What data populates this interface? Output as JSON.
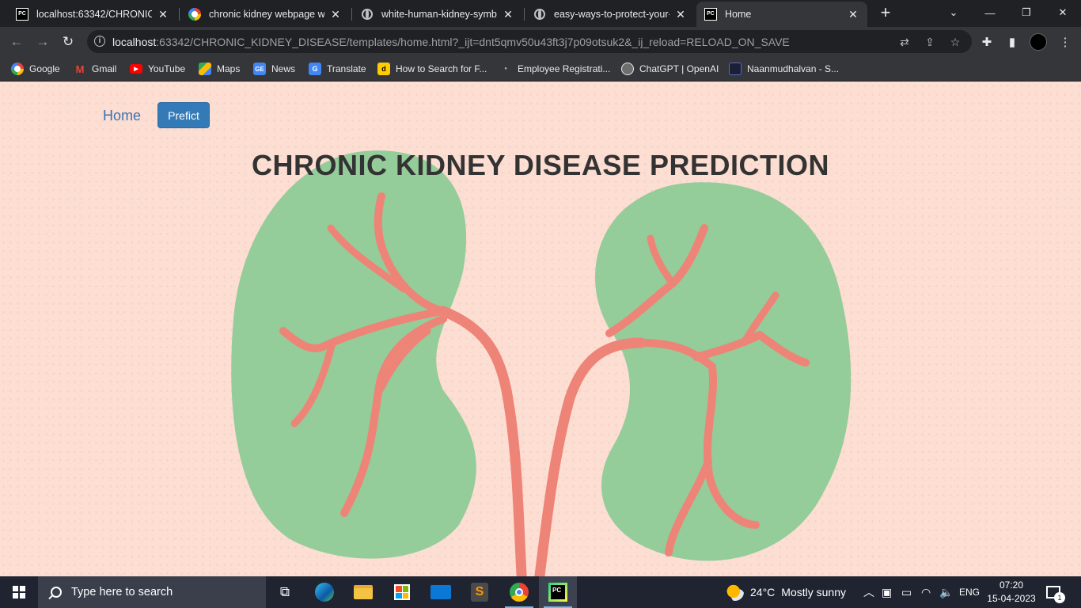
{
  "browser": {
    "tabs": [
      {
        "title": "localhost:63342/CHRONIC_KIDNEY",
        "icon": "pycharm-icon"
      },
      {
        "title": "chronic kidney webpage wallpaper",
        "icon": "google-icon"
      },
      {
        "title": "white-human-kidney-symbol",
        "icon": "globe-icon"
      },
      {
        "title": "easy-ways-to-protect-your-kidney",
        "icon": "globe-icon"
      },
      {
        "title": "Home",
        "icon": "pycharm-icon"
      }
    ],
    "new_tab": "+",
    "url_host": "localhost",
    "url_rest": ":63342/CHRONIC_KIDNEY_DISEASE/templates/home.html?_ijt=dnt5qmv50u43ft3j7p09otsuk2&_ij_reload=RELOAD_ON_SAVE",
    "bookmarks": [
      {
        "label": "Google",
        "icon": "google-icon"
      },
      {
        "label": "Gmail",
        "icon": "gmail-icon"
      },
      {
        "label": "YouTube",
        "icon": "youtube-icon"
      },
      {
        "label": "Maps",
        "icon": "maps-icon"
      },
      {
        "label": "News",
        "icon": "news-icon"
      },
      {
        "label": "Translate",
        "icon": "translate-icon"
      },
      {
        "label": "How to Search for F...",
        "icon": "dictionary-icon"
      },
      {
        "label": "Employee Registrati...",
        "icon": "dot-icon"
      },
      {
        "label": "ChatGPT | OpenAI",
        "icon": "openai-icon"
      },
      {
        "label": "Naanmudhalvan - S...",
        "icon": "site-icon"
      }
    ]
  },
  "page": {
    "nav_home": "Home",
    "nav_predict": "Prefict",
    "heading": "CHRONIC KIDNEY DISEASE PREDICTION",
    "colors": {
      "background": "#fcded3",
      "kidney": "#94cc9a",
      "vessel": "#ee8477",
      "button": "#337ab7"
    }
  },
  "taskbar": {
    "search_placeholder": "Type here to search",
    "weather_temp": "24°C",
    "weather_text": "Mostly sunny",
    "language": "ENG",
    "time": "07:20",
    "date": "15-04-2023",
    "notification_count": "1"
  }
}
